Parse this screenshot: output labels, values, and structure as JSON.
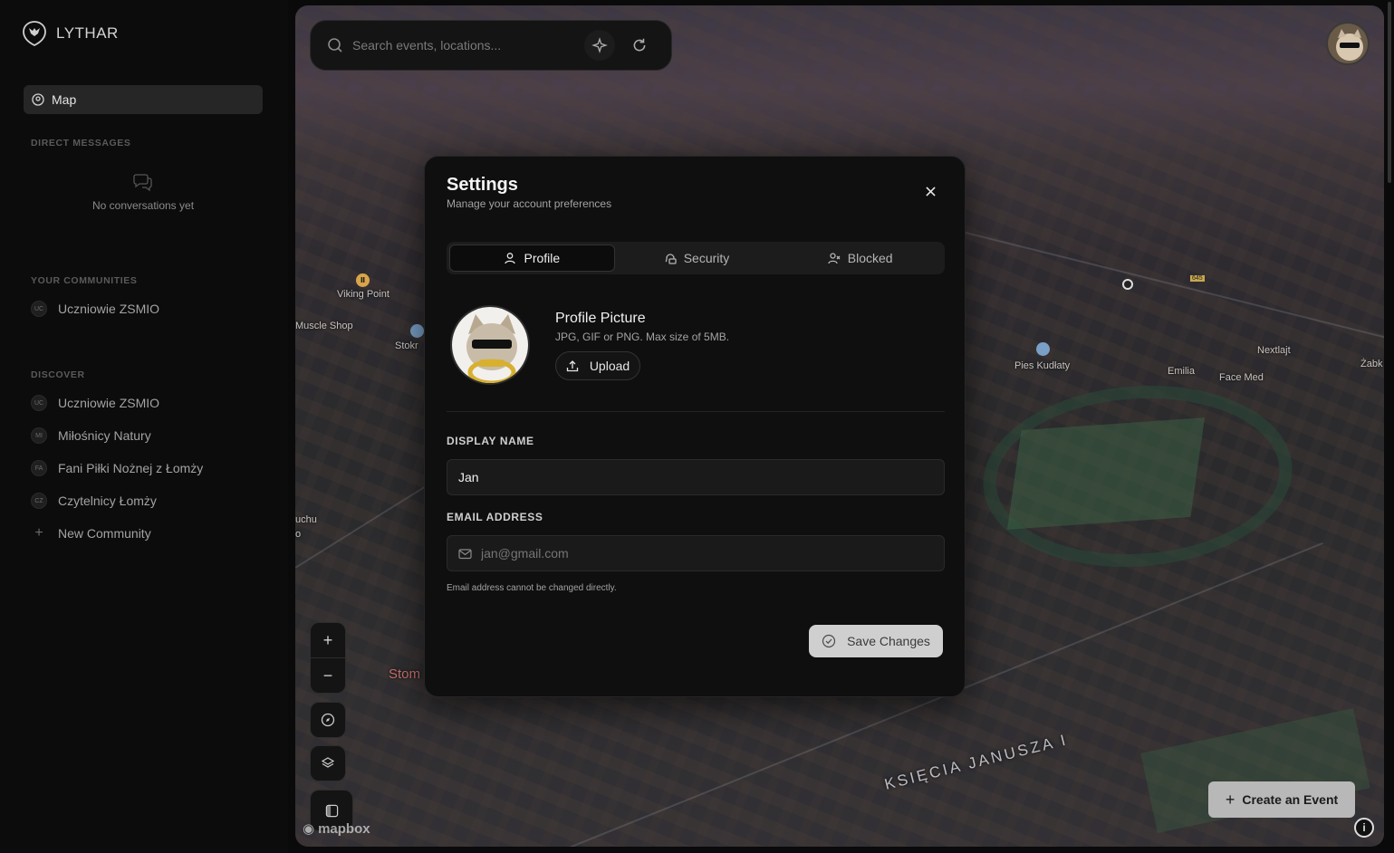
{
  "app": {
    "name": "LYTHAR"
  },
  "sidebar": {
    "map_label": "Map",
    "direct_messages": {
      "title": "DIRECT MESSAGES",
      "empty": "No conversations yet"
    },
    "your_communities": {
      "title": "YOUR COMMUNITIES",
      "items": [
        {
          "initials": "UC",
          "name": "Uczniowie ZSMIO"
        }
      ]
    },
    "discover": {
      "title": "DISCOVER",
      "items": [
        {
          "initials": "UC",
          "name": "Uczniowie ZSMIO"
        },
        {
          "initials": "MI",
          "name": "Miłośnicy Natury"
        },
        {
          "initials": "FA",
          "name": "Fani Piłki Nożnej z Łomży"
        },
        {
          "initials": "CZ",
          "name": "Czytelnicy Łomży"
        }
      ],
      "new_community": "New Community"
    }
  },
  "search": {
    "placeholder": "Search events, locations..."
  },
  "map": {
    "labels": [
      "Viking Point",
      "Muscle Shop",
      "Stokr",
      "Pies Kudłaty",
      "Emilia",
      "Face Med",
      "Nextlajt",
      "Żabk",
      "uchu",
      "o",
      "Stom",
      "645"
    ],
    "street": "KSIĘCIA JANUSZA I",
    "attribution": "mapbox",
    "create_event": "Create an Event"
  },
  "settings": {
    "title": "Settings",
    "subtitle": "Manage your account preferences",
    "tabs": [
      {
        "label": "Profile",
        "active": true
      },
      {
        "label": "Security",
        "active": false
      },
      {
        "label": "Blocked",
        "active": false
      }
    ],
    "profile_picture": {
      "title": "Profile Picture",
      "hint": "JPG, GIF or PNG. Max size of 5MB.",
      "upload_label": "Upload"
    },
    "display_name": {
      "label": "DISPLAY NAME",
      "value": "Jan"
    },
    "email": {
      "label": "EMAIL ADDRESS",
      "placeholder": "jan@gmail.com",
      "hint": "Email address cannot be changed directly."
    },
    "save_label": "Save Changes"
  },
  "colors": {
    "accent": "#cfcfcf",
    "background": "#0a0a0a",
    "modal": "#0f0f0f"
  }
}
